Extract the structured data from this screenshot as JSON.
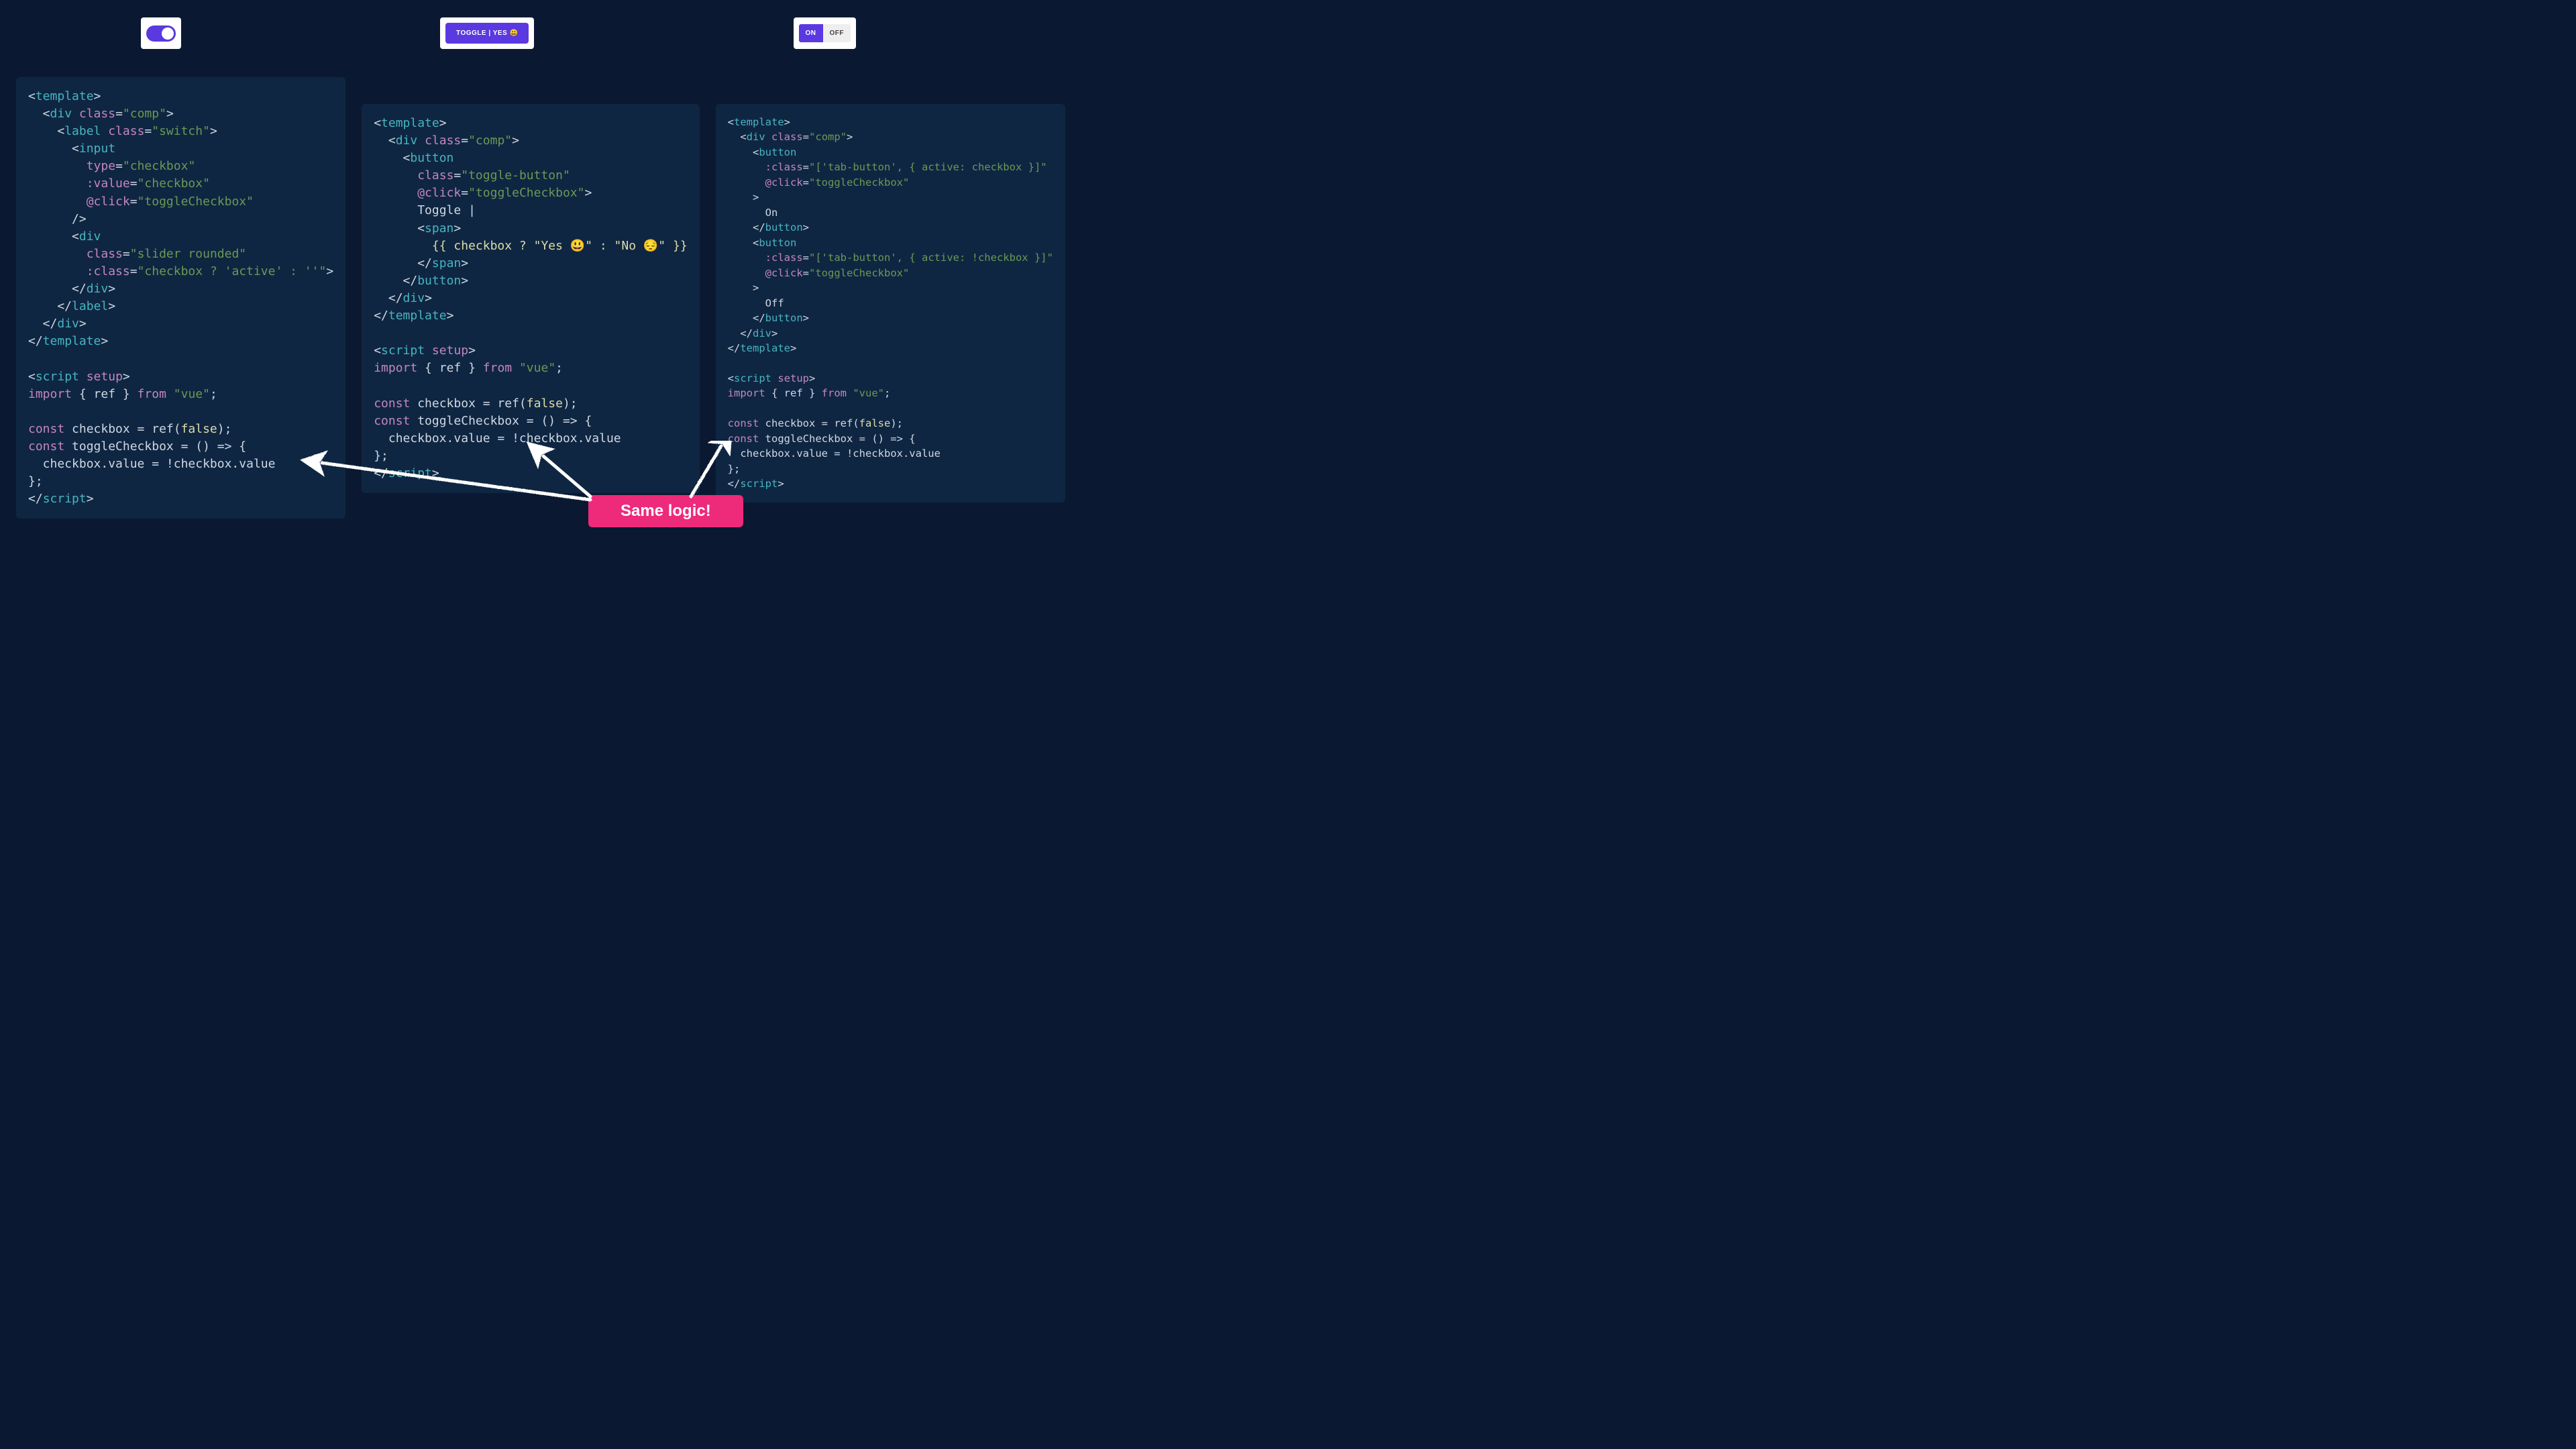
{
  "demos": {
    "toggle_button_label": "TOGGLE | YES 😃",
    "on_label": "ON",
    "off_label": "OFF"
  },
  "callout": "Same logic!",
  "code": {
    "col1": {
      "lines": [
        [
          [
            "t-pun",
            "<"
          ],
          [
            "t-tag",
            "template"
          ],
          [
            "t-pun",
            ">"
          ]
        ],
        [
          [
            "t-pun",
            "  <"
          ],
          [
            "t-tag",
            "div"
          ],
          [
            "t-pun",
            " "
          ],
          [
            "t-attr",
            "class"
          ],
          [
            "t-pun",
            "="
          ],
          [
            "t-str",
            "\"comp\""
          ],
          [
            "t-pun",
            ">"
          ]
        ],
        [
          [
            "t-pun",
            "    <"
          ],
          [
            "t-tag",
            "label"
          ],
          [
            "t-pun",
            " "
          ],
          [
            "t-attr",
            "class"
          ],
          [
            "t-pun",
            "="
          ],
          [
            "t-str",
            "\"switch\""
          ],
          [
            "t-pun",
            ">"
          ]
        ],
        [
          [
            "t-pun",
            "      <"
          ],
          [
            "t-tag",
            "input"
          ]
        ],
        [
          [
            "t-pun",
            "        "
          ],
          [
            "t-attr",
            "type"
          ],
          [
            "t-pun",
            "="
          ],
          [
            "t-str",
            "\"checkbox\""
          ]
        ],
        [
          [
            "t-pun",
            "        "
          ],
          [
            "t-attr",
            ":value"
          ],
          [
            "t-pun",
            "="
          ],
          [
            "t-str",
            "\"checkbox\""
          ]
        ],
        [
          [
            "t-pun",
            "        "
          ],
          [
            "t-attr",
            "@click"
          ],
          [
            "t-pun",
            "="
          ],
          [
            "t-str",
            "\"toggleCheckbox\""
          ]
        ],
        [
          [
            "t-pun",
            "      />"
          ]
        ],
        [
          [
            "t-pun",
            "      <"
          ],
          [
            "t-tag",
            "div"
          ]
        ],
        [
          [
            "t-pun",
            "        "
          ],
          [
            "t-attr",
            "class"
          ],
          [
            "t-pun",
            "="
          ],
          [
            "t-str",
            "\"slider rounded\""
          ]
        ],
        [
          [
            "t-pun",
            "        "
          ],
          [
            "t-attr",
            ":class"
          ],
          [
            "t-pun",
            "="
          ],
          [
            "t-str",
            "\"checkbox ? 'active' : ''\""
          ],
          [
            "t-pun",
            ">"
          ]
        ],
        [
          [
            "t-pun",
            "      </"
          ],
          [
            "t-tag",
            "div"
          ],
          [
            "t-pun",
            ">"
          ]
        ],
        [
          [
            "t-pun",
            "    </"
          ],
          [
            "t-tag",
            "label"
          ],
          [
            "t-pun",
            ">"
          ]
        ],
        [
          [
            "t-pun",
            "  </"
          ],
          [
            "t-tag",
            "div"
          ],
          [
            "t-pun",
            ">"
          ]
        ],
        [
          [
            "t-pun",
            "</"
          ],
          [
            "t-tag",
            "template"
          ],
          [
            "t-pun",
            ">"
          ]
        ],
        [
          [
            "t-pun",
            ""
          ]
        ],
        [
          [
            "t-pun",
            "<"
          ],
          [
            "t-tag",
            "script"
          ],
          [
            "t-pun",
            " "
          ],
          [
            "t-attr",
            "setup"
          ],
          [
            "t-pun",
            ">"
          ]
        ],
        [
          [
            "t-kw",
            "import"
          ],
          [
            "t-pun",
            " { ref } "
          ],
          [
            "t-kw",
            "from"
          ],
          [
            "t-pun",
            " "
          ],
          [
            "t-str",
            "\"vue\""
          ],
          [
            "t-pun",
            ";"
          ]
        ],
        [
          [
            "t-pun",
            ""
          ]
        ],
        [
          [
            "t-kw",
            "const"
          ],
          [
            "t-pun",
            " checkbox = ref("
          ],
          [
            "t-lit",
            "false"
          ],
          [
            "t-pun",
            ");"
          ]
        ],
        [
          [
            "t-kw",
            "const"
          ],
          [
            "t-pun",
            " toggleCheckbox = () => {"
          ]
        ],
        [
          [
            "t-pun",
            "  checkbox.value = !checkbox.value"
          ]
        ],
        [
          [
            "t-pun",
            "};"
          ]
        ],
        [
          [
            "t-pun",
            "</"
          ],
          [
            "t-tag",
            "script"
          ],
          [
            "t-pun",
            ">"
          ]
        ]
      ]
    },
    "col2": {
      "lines": [
        [
          [
            "t-pun",
            "<"
          ],
          [
            "t-tag",
            "template"
          ],
          [
            "t-pun",
            ">"
          ]
        ],
        [
          [
            "t-pun",
            "  <"
          ],
          [
            "t-tag",
            "div"
          ],
          [
            "t-pun",
            " "
          ],
          [
            "t-attr",
            "class"
          ],
          [
            "t-pun",
            "="
          ],
          [
            "t-str",
            "\"comp\""
          ],
          [
            "t-pun",
            ">"
          ]
        ],
        [
          [
            "t-pun",
            "    <"
          ],
          [
            "t-tag",
            "button"
          ]
        ],
        [
          [
            "t-pun",
            "      "
          ],
          [
            "t-attr",
            "class"
          ],
          [
            "t-pun",
            "="
          ],
          [
            "t-str",
            "\"toggle-button\""
          ]
        ],
        [
          [
            "t-pun",
            "      "
          ],
          [
            "t-attr",
            "@click"
          ],
          [
            "t-pun",
            "="
          ],
          [
            "t-str",
            "\"toggleCheckbox\""
          ],
          [
            "t-pun",
            ">"
          ]
        ],
        [
          [
            "t-pun",
            "      Toggle |"
          ]
        ],
        [
          [
            "t-pun",
            "      <"
          ],
          [
            "t-tag",
            "span"
          ],
          [
            "t-pun",
            ">"
          ]
        ],
        [
          [
            "t-pun",
            "        "
          ],
          [
            "t-mustache",
            "{{ checkbox ? \"Yes 😃\" : \"No 😔\" }}"
          ]
        ],
        [
          [
            "t-pun",
            "      </"
          ],
          [
            "t-tag",
            "span"
          ],
          [
            "t-pun",
            ">"
          ]
        ],
        [
          [
            "t-pun",
            "    </"
          ],
          [
            "t-tag",
            "button"
          ],
          [
            "t-pun",
            ">"
          ]
        ],
        [
          [
            "t-pun",
            "  </"
          ],
          [
            "t-tag",
            "div"
          ],
          [
            "t-pun",
            ">"
          ]
        ],
        [
          [
            "t-pun",
            "</"
          ],
          [
            "t-tag",
            "template"
          ],
          [
            "t-pun",
            ">"
          ]
        ],
        [
          [
            "t-pun",
            ""
          ]
        ],
        [
          [
            "t-pun",
            "<"
          ],
          [
            "t-tag",
            "script"
          ],
          [
            "t-pun",
            " "
          ],
          [
            "t-attr",
            "setup"
          ],
          [
            "t-pun",
            ">"
          ]
        ],
        [
          [
            "t-kw",
            "import"
          ],
          [
            "t-pun",
            " { ref } "
          ],
          [
            "t-kw",
            "from"
          ],
          [
            "t-pun",
            " "
          ],
          [
            "t-str",
            "\"vue\""
          ],
          [
            "t-pun",
            ";"
          ]
        ],
        [
          [
            "t-pun",
            ""
          ]
        ],
        [
          [
            "t-kw",
            "const"
          ],
          [
            "t-pun",
            " checkbox = ref("
          ],
          [
            "t-lit",
            "false"
          ],
          [
            "t-pun",
            ");"
          ]
        ],
        [
          [
            "t-kw",
            "const"
          ],
          [
            "t-pun",
            " toggleCheckbox = () => {"
          ]
        ],
        [
          [
            "t-pun",
            "  checkbox.value = !checkbox.value"
          ]
        ],
        [
          [
            "t-pun",
            "};"
          ]
        ],
        [
          [
            "t-pun",
            "</"
          ],
          [
            "t-tag",
            "script"
          ],
          [
            "t-pun",
            ">"
          ]
        ]
      ]
    },
    "col3": {
      "lines": [
        [
          [
            "t-pun",
            "<"
          ],
          [
            "t-tag",
            "template"
          ],
          [
            "t-pun",
            ">"
          ]
        ],
        [
          [
            "t-pun",
            "  <"
          ],
          [
            "t-tag",
            "div"
          ],
          [
            "t-pun",
            " "
          ],
          [
            "t-attr",
            "class"
          ],
          [
            "t-pun",
            "="
          ],
          [
            "t-str",
            "\"comp\""
          ],
          [
            "t-pun",
            ">"
          ]
        ],
        [
          [
            "t-pun",
            "    <"
          ],
          [
            "t-tag",
            "button"
          ]
        ],
        [
          [
            "t-pun",
            "      "
          ],
          [
            "t-attr",
            ":class"
          ],
          [
            "t-pun",
            "="
          ],
          [
            "t-str",
            "\"['tab-button', { active: checkbox }]\""
          ]
        ],
        [
          [
            "t-pun",
            "      "
          ],
          [
            "t-attr",
            "@click"
          ],
          [
            "t-pun",
            "="
          ],
          [
            "t-str",
            "\"toggleCheckbox\""
          ]
        ],
        [
          [
            "t-pun",
            "    >"
          ]
        ],
        [
          [
            "t-pun",
            "      On"
          ]
        ],
        [
          [
            "t-pun",
            "    </"
          ],
          [
            "t-tag",
            "button"
          ],
          [
            "t-pun",
            ">"
          ]
        ],
        [
          [
            "t-pun",
            "    <"
          ],
          [
            "t-tag",
            "button"
          ]
        ],
        [
          [
            "t-pun",
            "      "
          ],
          [
            "t-attr",
            ":class"
          ],
          [
            "t-pun",
            "="
          ],
          [
            "t-str",
            "\"['tab-button', { active: !checkbox }]\""
          ]
        ],
        [
          [
            "t-pun",
            "      "
          ],
          [
            "t-attr",
            "@click"
          ],
          [
            "t-pun",
            "="
          ],
          [
            "t-str",
            "\"toggleCheckbox\""
          ]
        ],
        [
          [
            "t-pun",
            "    >"
          ]
        ],
        [
          [
            "t-pun",
            "      Off"
          ]
        ],
        [
          [
            "t-pun",
            "    </"
          ],
          [
            "t-tag",
            "button"
          ],
          [
            "t-pun",
            ">"
          ]
        ],
        [
          [
            "t-pun",
            "  </"
          ],
          [
            "t-tag",
            "div"
          ],
          [
            "t-pun",
            ">"
          ]
        ],
        [
          [
            "t-pun",
            "</"
          ],
          [
            "t-tag",
            "template"
          ],
          [
            "t-pun",
            ">"
          ]
        ],
        [
          [
            "t-pun",
            ""
          ]
        ],
        [
          [
            "t-pun",
            "<"
          ],
          [
            "t-tag",
            "script"
          ],
          [
            "t-pun",
            " "
          ],
          [
            "t-attr",
            "setup"
          ],
          [
            "t-pun",
            ">"
          ]
        ],
        [
          [
            "t-kw",
            "import"
          ],
          [
            "t-pun",
            " { ref } "
          ],
          [
            "t-kw",
            "from"
          ],
          [
            "t-pun",
            " "
          ],
          [
            "t-str",
            "\"vue\""
          ],
          [
            "t-pun",
            ";"
          ]
        ],
        [
          [
            "t-pun",
            ""
          ]
        ],
        [
          [
            "t-kw",
            "const"
          ],
          [
            "t-pun",
            " checkbox = ref("
          ],
          [
            "t-lit",
            "false"
          ],
          [
            "t-pun",
            ");"
          ]
        ],
        [
          [
            "t-kw",
            "const"
          ],
          [
            "t-pun",
            " toggleCheckbox = () => {"
          ]
        ],
        [
          [
            "t-pun",
            "  checkbox.value = !checkbox.value"
          ]
        ],
        [
          [
            "t-pun",
            "};"
          ]
        ],
        [
          [
            "t-pun",
            "</"
          ],
          [
            "t-tag",
            "script"
          ],
          [
            "t-pun",
            ">"
          ]
        ]
      ]
    }
  }
}
